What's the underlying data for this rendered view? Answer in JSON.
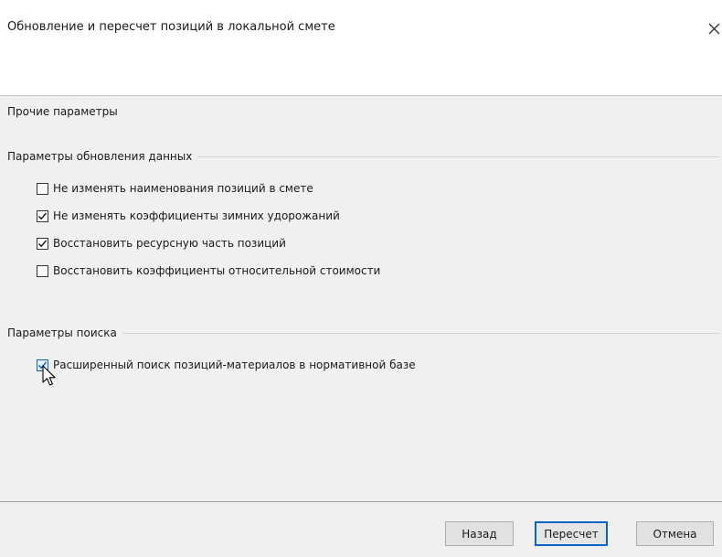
{
  "dialog": {
    "title": "Обновление и пересчет позиций в локальной смете",
    "close_icon": "close-icon"
  },
  "section_other": {
    "label": "Прочие параметры"
  },
  "update_params": {
    "label": "Параметры обновления данных",
    "options": [
      {
        "label": "Не изменять наименования позиций в смете",
        "checked": false
      },
      {
        "label": "Не изменять коэффициенты зимних удорожаний",
        "checked": true
      },
      {
        "label": "Восстановить ресурсную часть позиций",
        "checked": true
      },
      {
        "label": "Восстановить коэффициенты относительной стоимости",
        "checked": false
      }
    ]
  },
  "search_params": {
    "label": "Параметры поиска",
    "options": [
      {
        "label": "Расширенный поиск позиций-материалов в нормативной базе",
        "checked": true
      }
    ]
  },
  "buttons": {
    "back": "Назад",
    "recalc": "Пересчет",
    "cancel": "Отмена"
  },
  "colors": {
    "accent": "#0a64c8",
    "background": "#f0f0f0",
    "header_background": "#ffffff"
  }
}
